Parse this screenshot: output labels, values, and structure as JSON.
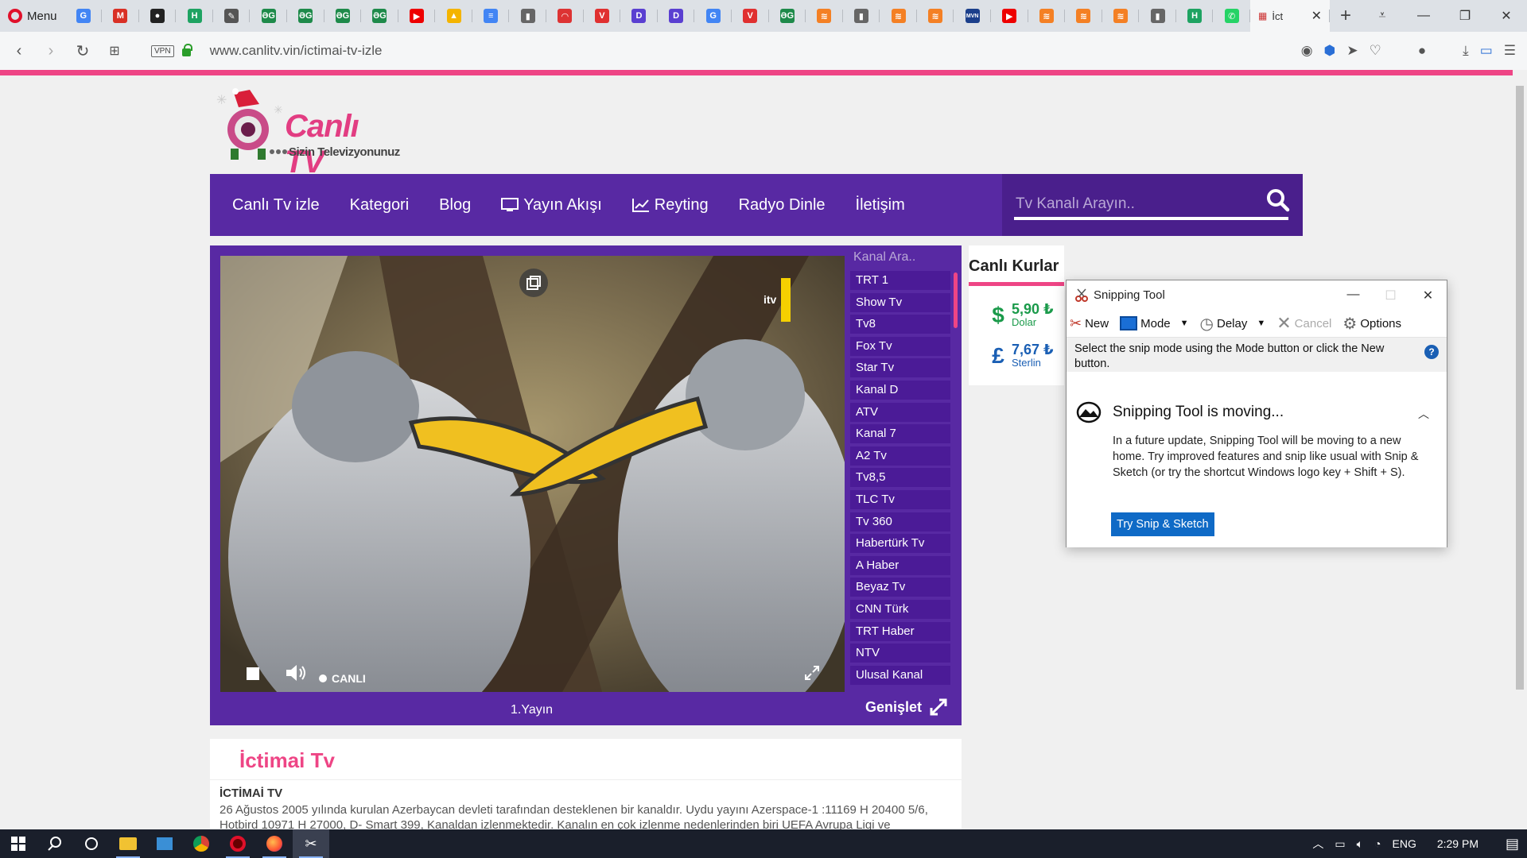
{
  "browser": {
    "menu_label": "Menu",
    "tabs": [
      {
        "icon": "google-docs-icon",
        "color": "#4285f4",
        "letter": "G"
      },
      {
        "icon": "gmail-icon",
        "color": "#d93025",
        "letter": "M"
      },
      {
        "icon": "github-icon",
        "color": "#222",
        "letter": "●"
      },
      {
        "icon": "h-site-icon",
        "color": "#1ea362",
        "letter": "H"
      },
      {
        "icon": "edit-icon",
        "color": "#555",
        "letter": "✎"
      },
      {
        "icon": "dg-site-icon",
        "color": "#1e8a4a",
        "letter": "ƏG"
      },
      {
        "icon": "dg-site-icon",
        "color": "#1e8a4a",
        "letter": "ƏG"
      },
      {
        "icon": "dg-site-icon",
        "color": "#1e8a4a",
        "letter": "ƏG"
      },
      {
        "icon": "dg-site-icon",
        "color": "#1e8a4a",
        "letter": "ƏG"
      },
      {
        "icon": "youtube-icon",
        "color": "#e00",
        "letter": "▶"
      },
      {
        "icon": "google-drive-icon",
        "color": "#f4b400",
        "letter": "▲"
      },
      {
        "icon": "google-docs-icon",
        "color": "#4285f4",
        "letter": "≡"
      },
      {
        "icon": "document-icon",
        "color": "#666",
        "letter": "▮"
      },
      {
        "icon": "gauge-icon",
        "color": "#d33",
        "letter": "◠"
      },
      {
        "icon": "v-site-icon",
        "color": "#e03030",
        "letter": "V"
      },
      {
        "icon": "d-site-icon",
        "color": "#5a3fd1",
        "letter": "D"
      },
      {
        "icon": "d-site-icon",
        "color": "#5a3fd1",
        "letter": "D"
      },
      {
        "icon": "google-icon",
        "color": "#4285f4",
        "letter": "G"
      },
      {
        "icon": "v-site-icon",
        "color": "#e03030",
        "letter": "V"
      },
      {
        "icon": "dg-site-icon",
        "color": "#1e8a4a",
        "letter": "ƏG"
      },
      {
        "icon": "stack-icon",
        "color": "#f48024",
        "letter": "≋"
      },
      {
        "icon": "document-icon",
        "color": "#666",
        "letter": "▮"
      },
      {
        "icon": "stack-icon",
        "color": "#f48024",
        "letter": "≋"
      },
      {
        "icon": "stack-icon",
        "color": "#f48024",
        "letter": "≋"
      },
      {
        "icon": "mvn-icon",
        "color": "#1b3f8b",
        "letter": "MVN"
      },
      {
        "icon": "youtube-icon",
        "color": "#e00",
        "letter": "▶"
      },
      {
        "icon": "stack-icon",
        "color": "#f48024",
        "letter": "≋"
      },
      {
        "icon": "stack-icon",
        "color": "#f48024",
        "letter": "≋"
      },
      {
        "icon": "stack-icon",
        "color": "#f48024",
        "letter": "≋"
      },
      {
        "icon": "document-icon",
        "color": "#666",
        "letter": "▮"
      },
      {
        "icon": "h-site-icon",
        "color": "#1ea362",
        "letter": "H"
      },
      {
        "icon": "whatsapp-icon",
        "color": "#25d366",
        "letter": "✆"
      }
    ],
    "active_tab": "İct",
    "url": "www.canlitv.vin/ictimai-tv-izle",
    "vpn": "VPN"
  },
  "site": {
    "logo_title": "Canlı TV",
    "logo_sub": "Sizin Televizyonunuz",
    "nav": [
      "Canlı Tv izle",
      "Kategori",
      "Blog",
      "Yayın Akışı",
      "Reyting",
      "Radyo Dinle",
      "İletişim"
    ],
    "search_placeholder": "Tv Kanalı Arayın..",
    "player": {
      "live_label": "CANLI",
      "footer_title": "1.Yayın",
      "expand_label": "Genişlet",
      "channel_search": "Kanal Ara..",
      "watermark": "itv"
    },
    "channels": [
      "TRT 1",
      "Show Tv",
      "Tv8",
      "Fox Tv",
      "Star Tv",
      "Kanal D",
      "ATV",
      "Kanal 7",
      "A2 Tv",
      "Tv8,5",
      "TLC Tv",
      "Tv 360",
      "Habertürk Tv",
      "A Haber",
      "Beyaz Tv",
      "CNN Türk",
      "TRT Haber",
      "NTV",
      "Ulusal Kanal"
    ],
    "rates": {
      "title": "Canlı Kurlar",
      "items": [
        {
          "symbol": "$",
          "value": "5,90 ₺",
          "label": "Dolar"
        },
        {
          "symbol": "£",
          "value": "7,67 ₺",
          "label": "Sterlin"
        }
      ]
    },
    "content": {
      "title": "İctimai Tv",
      "subtitle": "İCTİMAİ TV",
      "body": "26 Ağustos 2005 yılında kurulan Azerbaycan devleti tarafından desteklenen bir kanaldır. Uydu yayını Azerspace-1 :11169 H 20400 5/6, Hotbird 10971 H 27000, D- Smart 399, Kanaldan izlenmektedir. Kanalın en çok izlenme nedenlerinden biri UEFA Avrupa Ligi ve"
    },
    "colors": {
      "brand_purple": "#5829a3",
      "brand_pink": "#ee4585"
    }
  },
  "snipping_tool": {
    "title": "Snipping Tool",
    "toolbar": {
      "new": "New",
      "mode": "Mode",
      "delay": "Delay",
      "cancel": "Cancel",
      "options": "Options"
    },
    "hint": "Select the snip mode using the Mode button or click the New button.",
    "moving_title": "Snipping Tool is moving...",
    "moving_body": "In a future update, Snipping Tool will be moving to a new home. Try improved features and snip like usual with Snip & Sketch (or try the shortcut Windows logo key + Shift + S).",
    "try_button": "Try Snip & Sketch"
  },
  "taskbar": {
    "lang": "ENG",
    "time": "2:29 PM"
  }
}
